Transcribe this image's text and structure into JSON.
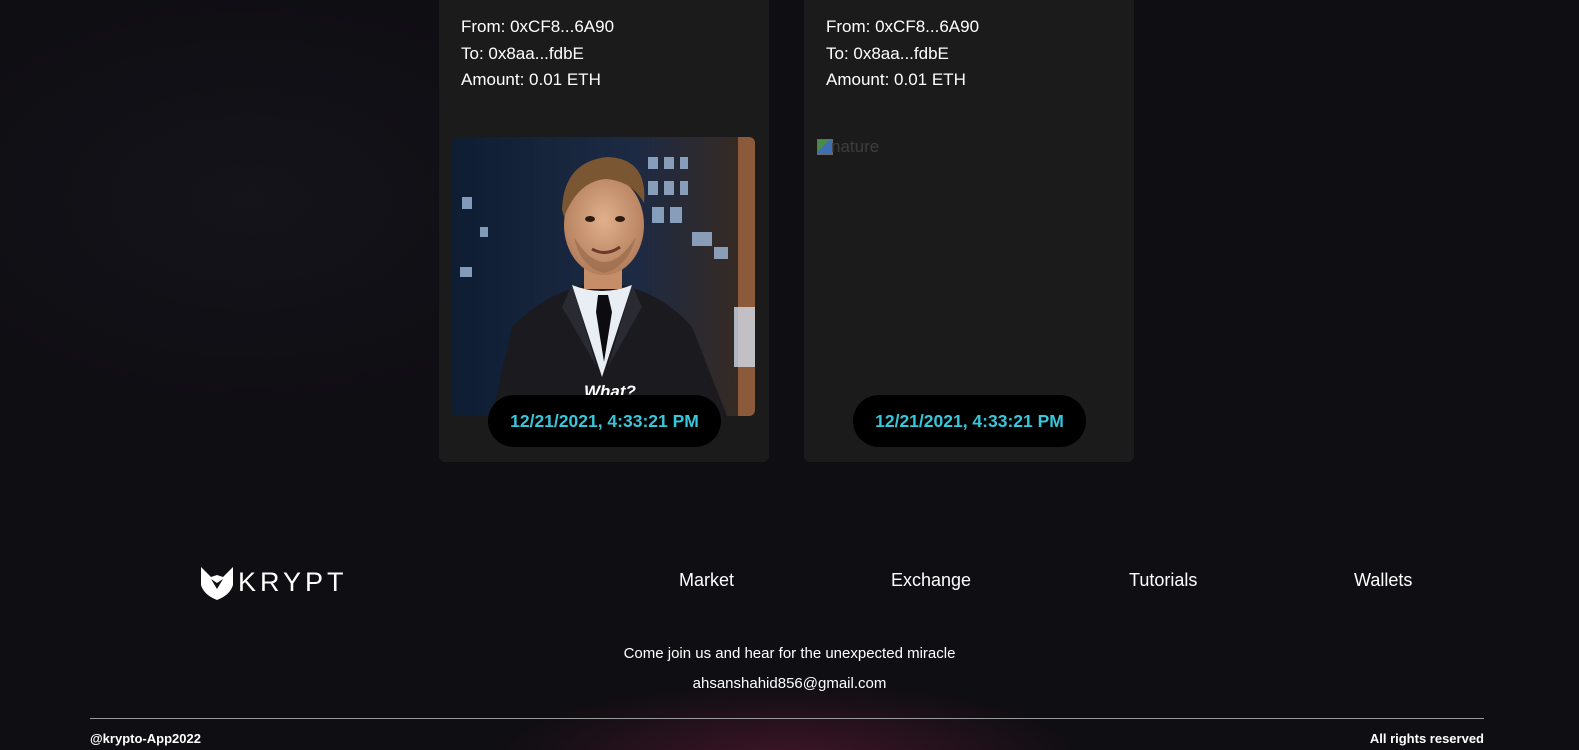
{
  "transactions": [
    {
      "from": "From: 0xCF8...6A90",
      "to": "To: 0x8aa...fdbE",
      "amount": "Amount: 0.01 ETH",
      "gif_caption": "What?",
      "timestamp": "12/21/2021, 4:33:21 PM"
    },
    {
      "from": "From: 0xCF8...6A90",
      "to": "To: 0x8aa...fdbE",
      "amount": "Amount: 0.01 ETH",
      "image_alt": "nature",
      "timestamp": "12/21/2021, 4:33:21 PM"
    }
  ],
  "footer": {
    "logo_text": "KRYPT",
    "logo_icon": "fox-icon",
    "nav": {
      "market": "Market",
      "exchange": "Exchange",
      "tutorials": "Tutorials",
      "wallets": "Wallets"
    },
    "tagline": "Come join us and hear for the unexpected miracle",
    "email": "ahsanshahid856@gmail.com",
    "copyright": "@krypto-App2022",
    "rights": "All rights reserved"
  },
  "colors": {
    "background": "#0f0e13",
    "card": "#1b1b1b",
    "timestamp_text": "#37c7da",
    "timestamp_pill": "#000000"
  }
}
